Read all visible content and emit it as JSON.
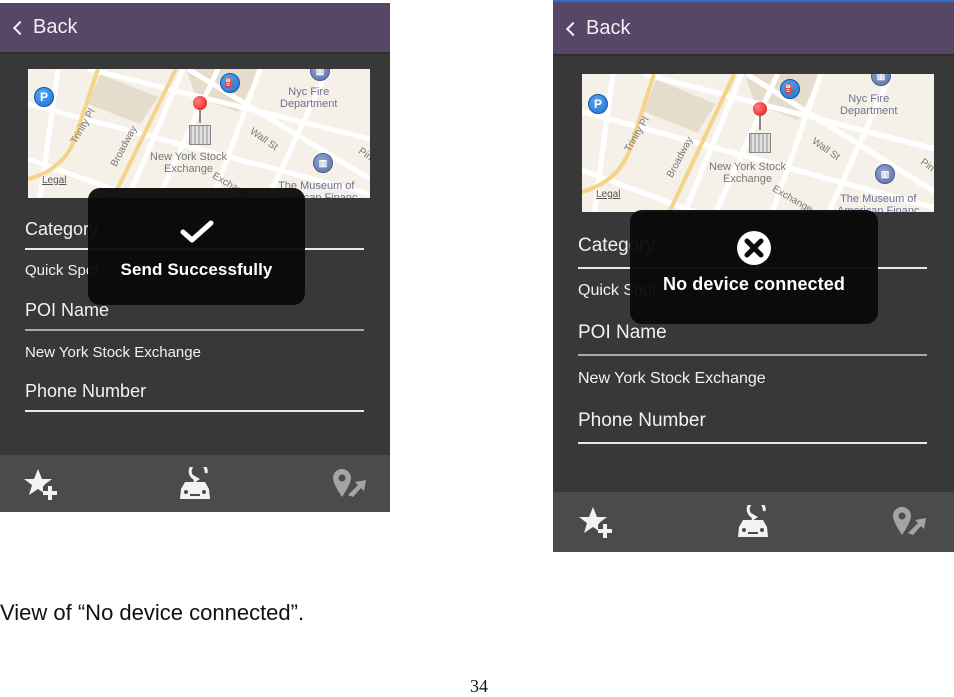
{
  "screens": [
    {
      "id": "left",
      "navbar": {
        "back_label": "Back"
      },
      "map": {
        "labels": {
          "fire_dept": "Nyc Fire\nDepartment",
          "nyse": "New York Stock\nExchange",
          "museum": "The Museum of\nAmerican Financ",
          "legal": "Legal",
          "trinity": "Trinity Pl",
          "broadway": "Broadway",
          "wall_st": "Wall St",
          "exchange": "Exchange",
          "pine": "Pin",
          "parking": "P"
        }
      },
      "form": {
        "category_label": "Category",
        "category_value": "Quick Spot",
        "poi_label": "POI Name",
        "poi_value": "New York Stock Exchange",
        "phone_label": "Phone Number"
      },
      "toast": {
        "icon": "checkmark-icon",
        "message": "Send Successfully"
      },
      "toolbar": [
        {
          "icon": "star-plus-icon",
          "label": "add-favorite"
        },
        {
          "icon": "car-send-icon",
          "label": "send-to-car"
        },
        {
          "icon": "pin-share-icon",
          "label": "share-location"
        }
      ]
    },
    {
      "id": "right",
      "navbar": {
        "back_label": "Back"
      },
      "map": {
        "labels": {
          "fire_dept": "Nyc Fire\nDepartment",
          "nyse": "New York Stock\nExchange",
          "museum": "The Museum of\nAmerican Financ",
          "legal": "Legal",
          "trinity": "Trinity Pl",
          "broadway": "Broadway",
          "wall_st": "Wall St",
          "exchange": "Exchange",
          "pine": "Pin",
          "parking": "P"
        }
      },
      "form": {
        "category_label": "Category",
        "category_value": "Quick Spot",
        "poi_label": "POI Name",
        "poi_value": "New York Stock Exchange",
        "phone_label": "Phone Number"
      },
      "toast": {
        "icon": "error-x-icon",
        "message": "No device connected"
      },
      "toolbar": [
        {
          "icon": "star-plus-icon",
          "label": "add-favorite"
        },
        {
          "icon": "car-send-icon",
          "label": "send-to-car"
        },
        {
          "icon": "pin-share-icon",
          "label": "share-location"
        }
      ]
    }
  ],
  "caption": "View of “No device connected”.",
  "page_number": "34",
  "colors": {
    "navbar": "#564766",
    "background": "#383838",
    "toolbar": "#4b4b4b",
    "toast": "#080808",
    "pin": "#e01010"
  }
}
